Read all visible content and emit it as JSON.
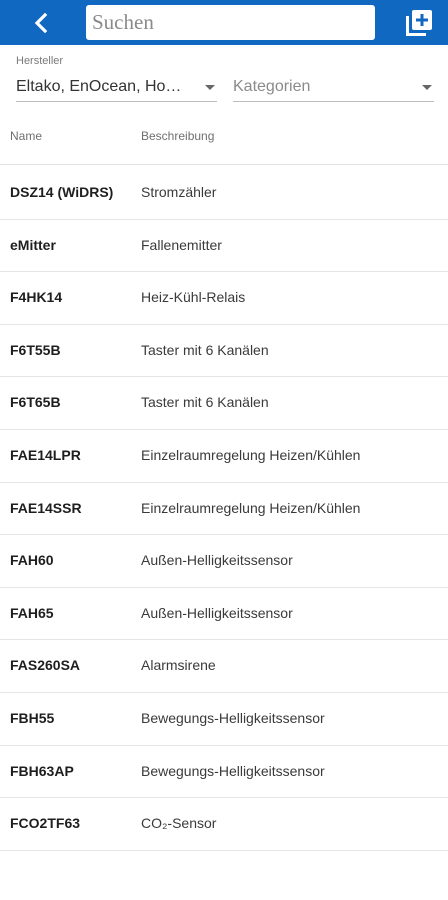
{
  "header": {
    "back_icon": "chevron-left-icon",
    "search_placeholder": "Suchen",
    "add_icon": "add-to-library-icon",
    "color": "#1168c0"
  },
  "filters": {
    "hersteller_label": "Hersteller",
    "hersteller_value": "Eltako, EnOcean, Ho…",
    "kategorien_placeholder": "Kategorien"
  },
  "table": {
    "columns": [
      "Name",
      "Beschreibung"
    ],
    "rows": [
      {
        "name": "DSZ14 (WiDRS)",
        "description": "Stromzähler"
      },
      {
        "name": "eMitter",
        "description": "Fallenemitter"
      },
      {
        "name": "F4HK14",
        "description": "Heiz-Kühl-Relais"
      },
      {
        "name": "F6T55B",
        "description": "Taster mit 6 Kanälen"
      },
      {
        "name": "F6T65B",
        "description": "Taster mit 6 Kanälen"
      },
      {
        "name": "FAE14LPR",
        "description": "Einzelraumregelung Heizen/Kühlen"
      },
      {
        "name": "FAE14SSR",
        "description": "Einzelraumregelung Heizen/Kühlen"
      },
      {
        "name": "FAH60",
        "description": "Außen-Helligkeitssensor"
      },
      {
        "name": "FAH65",
        "description": "Außen-Helligkeitssensor"
      },
      {
        "name": "FAS260SA",
        "description": "Alarmsirene"
      },
      {
        "name": "FBH55",
        "description": "Bewegungs-Helligkeitssensor"
      },
      {
        "name": "FBH63AP",
        "description": "Bewegungs-Helligkeitssensor"
      },
      {
        "name": "FCO2TF63",
        "description": "CO₂-Sensor"
      }
    ]
  }
}
